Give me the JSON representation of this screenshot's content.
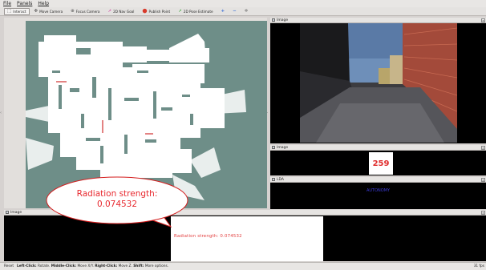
{
  "menu": {
    "file": "File",
    "panels": "Panels",
    "help": "Help"
  },
  "toolbar": {
    "interact": "Interact",
    "move_camera": "Move Camera",
    "focus_camera": "Focus Camera",
    "nav_goal": "2D Nav Goal",
    "publish_point": "Publish Point",
    "pose_estimate": "2D Pose Estimate",
    "plus": "+",
    "minus": "−"
  },
  "panels": {
    "image_camera": "Image",
    "image_counter": "Image",
    "lda": "LDA",
    "image_bottom": "Image"
  },
  "counter_value": "259",
  "lda_text": "AUTONOMY",
  "radiation_label": "Radiation strength: 0.074532",
  "callout": {
    "line1": "Radiation strength:",
    "line2": "0.074532"
  },
  "status": {
    "reset": "Reset",
    "left_click_key": "Left-Click:",
    "left_click_text": "Rotate.",
    "middle_click_key": "Middle-Click:",
    "middle_click_text": "Move X/Y.",
    "right_click_key": "Right-Click:",
    "right_click_text": "Move Z.",
    "shift_key": "Shift:",
    "shift_text": "More options.",
    "fps": "31 fps"
  },
  "colors": {
    "map_background": "#6e8e88",
    "map_free": "#ffffff",
    "callout_text": "#e8292f",
    "radiation_text": "#e23b3b",
    "counter_text": "#e02d2d",
    "lda_text": "#3b3bd7"
  }
}
